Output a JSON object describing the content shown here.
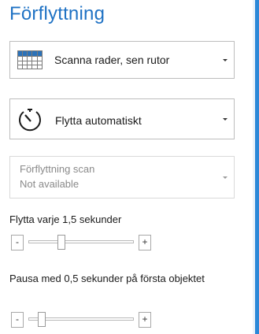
{
  "title": "Förflyttning",
  "scan_mode": {
    "icon": "grid-icon",
    "label": "Scanna rader, sen rutor"
  },
  "move_mode": {
    "icon": "timer-icon",
    "label": "Flytta automatiskt"
  },
  "scan_movement": {
    "label": "Förflyttning scan",
    "value": "Not available"
  },
  "move_interval": {
    "label": "Flytta varje 1,5 sekunder",
    "minus": "-",
    "plus": "+",
    "fraction": 0.3
  },
  "first_pause": {
    "label": "Pausa med 0,5 sekunder på första objektet",
    "minus": "-",
    "plus": "+",
    "fraction": 0.1
  },
  "colors": {
    "accent": "#1f72c4",
    "grid_header": "#2b72b9"
  }
}
